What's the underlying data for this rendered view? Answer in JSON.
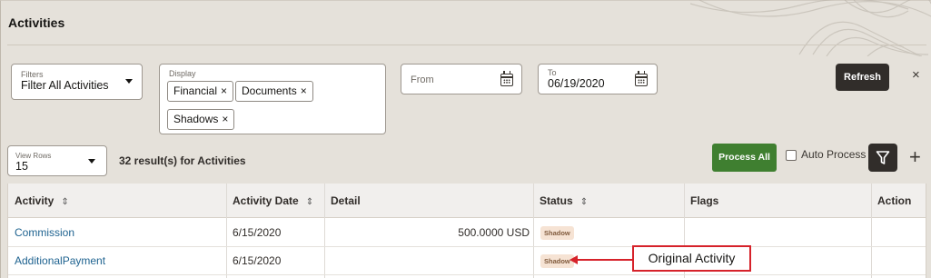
{
  "page": {
    "title": "Activities"
  },
  "filters": {
    "label": "Filters",
    "value": "Filter All Activities"
  },
  "display": {
    "label": "Display",
    "chips": [
      "Financial",
      "Documents",
      "Shadows"
    ],
    "remove_glyph": "×"
  },
  "from": {
    "placeholder": "From"
  },
  "to": {
    "label": "To",
    "value": "06/19/2020"
  },
  "toolbar": {
    "refresh_label": "Refresh",
    "close_glyph": "×",
    "process_all_label": "Process All",
    "auto_process_label": "Auto Process",
    "add_glyph": "+"
  },
  "view_rows": {
    "label": "View Rows",
    "value": "15"
  },
  "results_text": "32 result(s) for Activities",
  "table": {
    "headers": {
      "activity": "Activity",
      "activity_date": "Activity Date",
      "detail": "Detail",
      "status": "Status",
      "flags": "Flags",
      "action": "Action"
    },
    "sort_glyph": "⇕",
    "rows": [
      {
        "activity": "Commission",
        "activity_date": "6/15/2020",
        "detail": "500.0000 USD",
        "status": "Shadow",
        "flags": "",
        "action": ""
      },
      {
        "activity": "AdditionalPayment",
        "activity_date": "6/15/2020",
        "detail": "",
        "status": "Shadow",
        "flags": "",
        "action": ""
      }
    ]
  },
  "annotation": {
    "label": "Original Activity",
    "color": "#d6222a"
  },
  "colors": {
    "accent_green": "#3f7f30",
    "dark_button": "#312d2a",
    "link": "#1f6390",
    "badge_bg": "#f6e3d4"
  },
  "icons": [
    "calendar-icon",
    "filter-funnel-icon",
    "chevron-down-icon",
    "close-icon",
    "plus-icon",
    "sort-icon"
  ]
}
